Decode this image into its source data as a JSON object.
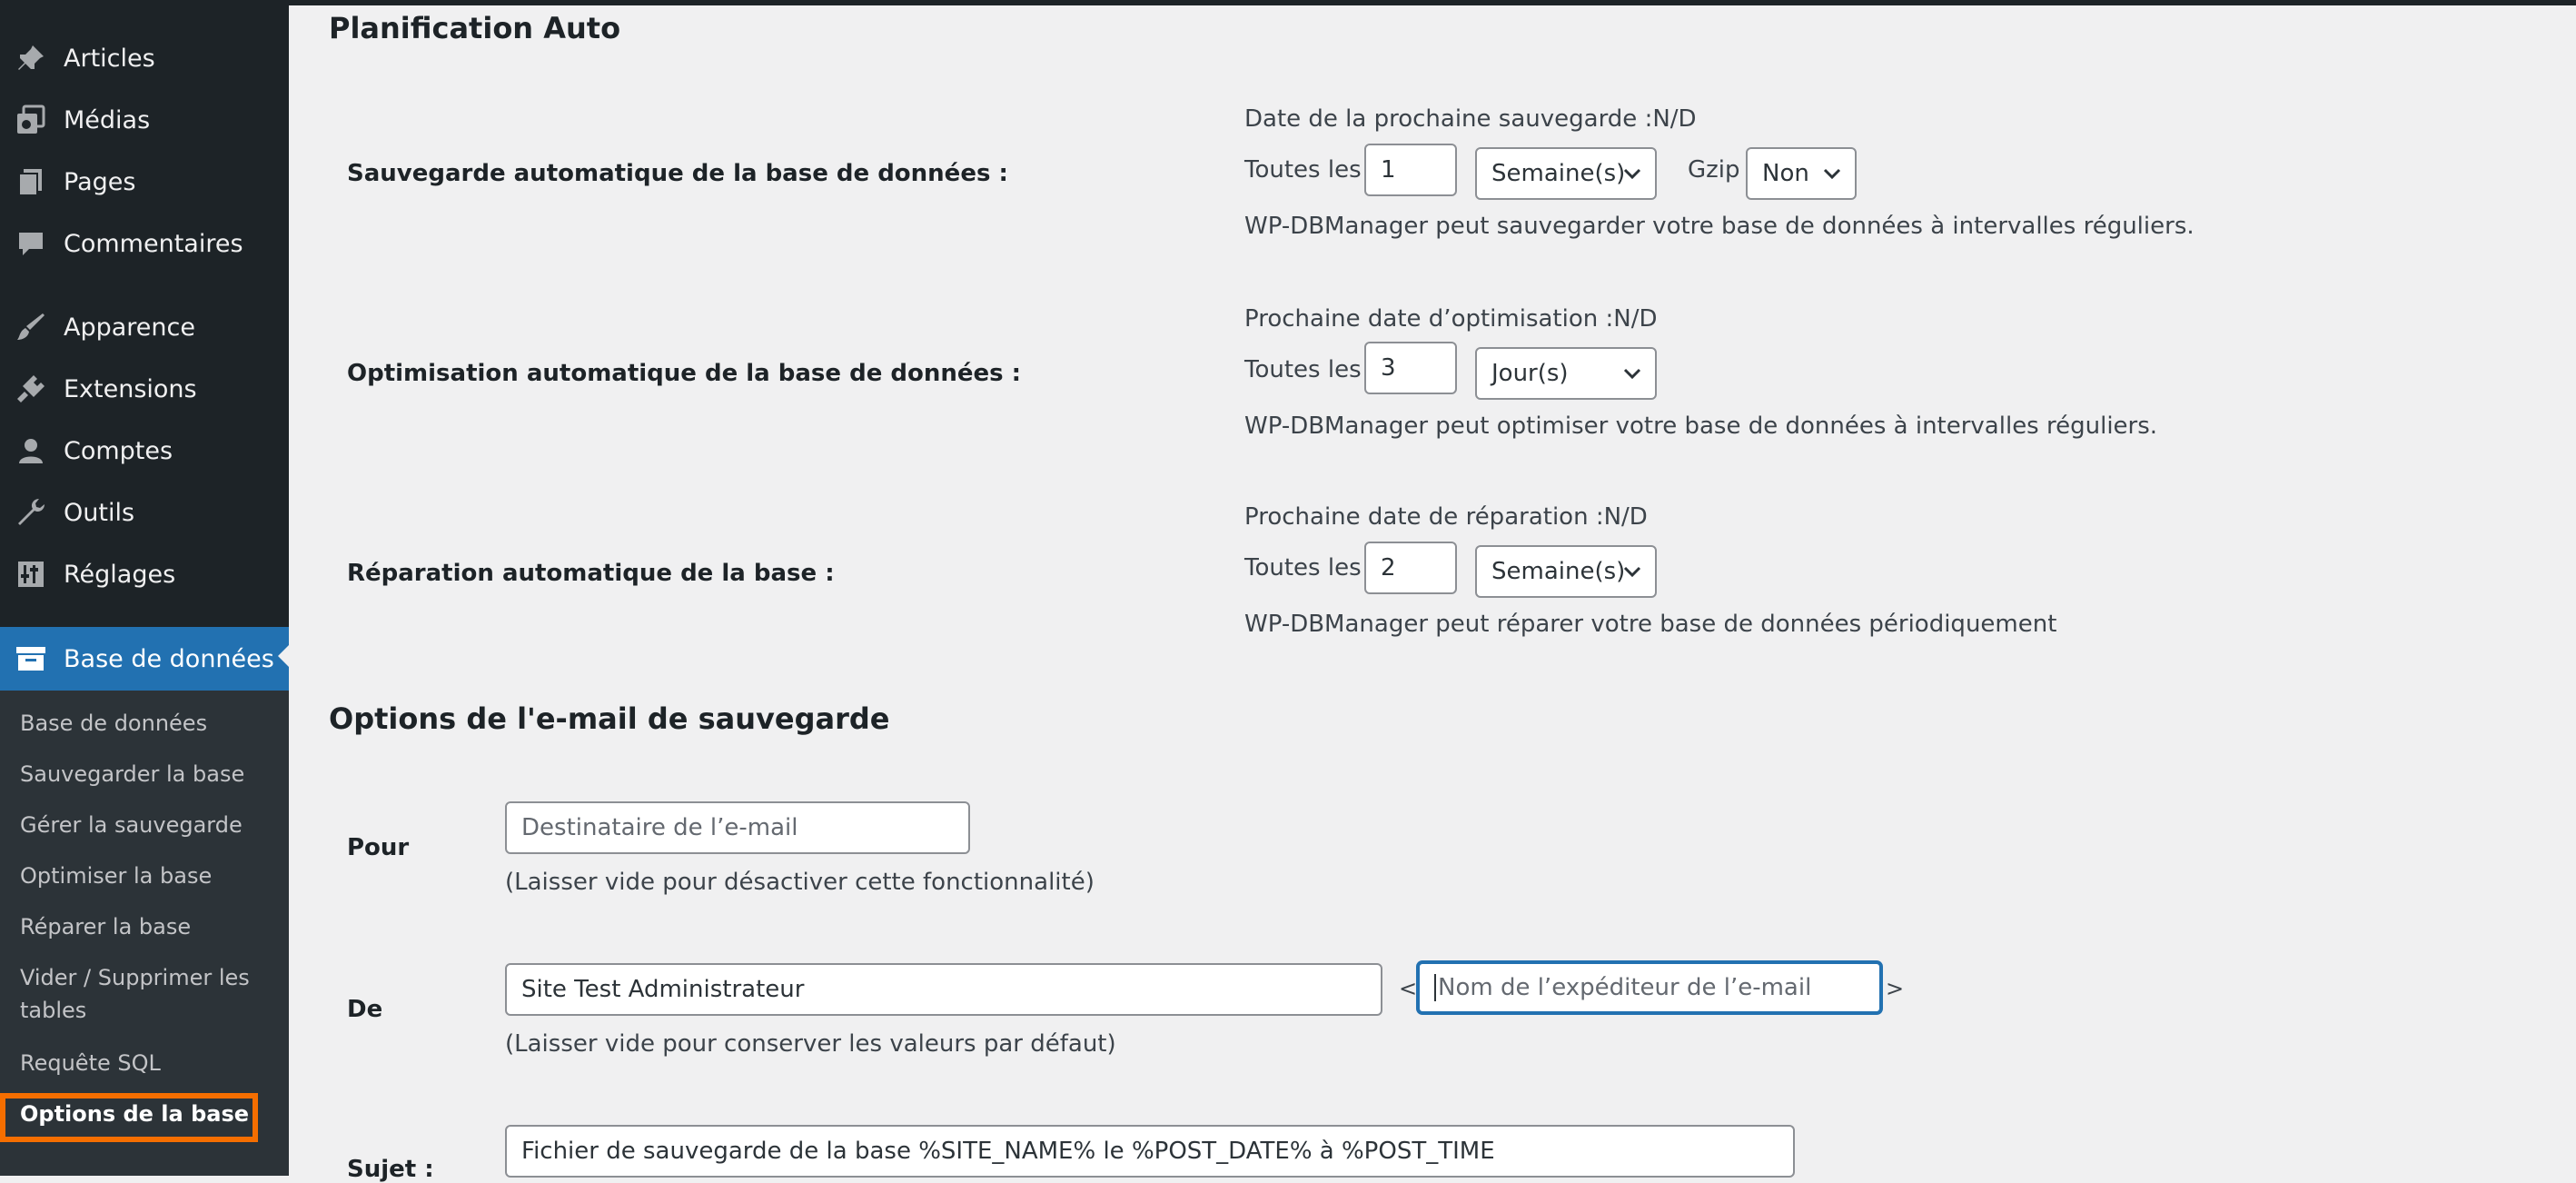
{
  "sidebar": {
    "items": [
      {
        "label": "Articles",
        "icon": "pushpin-icon"
      },
      {
        "label": "Médias",
        "icon": "media-icon"
      },
      {
        "label": "Pages",
        "icon": "pages-icon"
      },
      {
        "label": "Commentaires",
        "icon": "comment-icon"
      },
      {
        "label": "Apparence",
        "icon": "brush-icon"
      },
      {
        "label": "Extensions",
        "icon": "plugin-icon"
      },
      {
        "label": "Comptes",
        "icon": "user-icon"
      },
      {
        "label": "Outils",
        "icon": "wrench-icon"
      },
      {
        "label": "Réglages",
        "icon": "settings-icon"
      },
      {
        "label": "Base de données",
        "icon": "database-icon"
      }
    ],
    "submenu": [
      "Base de données",
      "Sauvegarder la base",
      "Gérer la sauvegarde",
      "Optimiser la base",
      "Réparer la base",
      "Vider / Supprimer les tables",
      "Requête SQL",
      "Options de la base"
    ]
  },
  "auto": {
    "title": "Planification Auto",
    "backup": {
      "label": "Sauvegarde automatique de la base de données :",
      "next": "Date de la prochaine sauvegarde :N/D",
      "every": "Toutes les",
      "value": "1",
      "unit": "Semaine(s)",
      "gzip_label": "Gzip",
      "gzip_value": "Non",
      "help": "WP-DBManager peut sauvegarder votre base de données à intervalles réguliers."
    },
    "optimize": {
      "label": "Optimisation automatique de la base de données :",
      "next": "Prochaine date d’optimisation :N/D",
      "every": "Toutes les",
      "value": "3",
      "unit": "Jour(s)",
      "help": "WP-DBManager peut optimiser votre base de données à intervalles réguliers."
    },
    "repair": {
      "label": "Réparation automatique de la base :",
      "next": "Prochaine date de réparation :N/D",
      "every": "Toutes les",
      "value": "2",
      "unit": "Semaine(s)",
      "help": "WP-DBManager peut réparer votre base de données périodiquement"
    }
  },
  "email": {
    "title": "Options de l'e-mail de sauvegarde",
    "to": {
      "label": "Pour",
      "placeholder": "Destinataire de l’e-mail",
      "help": "(Laisser vide pour désactiver cette fonctionnalité)"
    },
    "from": {
      "label": "De",
      "name_value": "Site Test Administrateur",
      "lt": "<",
      "gt": ">",
      "email_placeholder": "Nom de l’expéditeur de l’e-mail",
      "help": "(Laisser vide pour conserver les valeurs par défaut)"
    },
    "subject": {
      "label": "Sujet :",
      "value": "Fichier de sauvegarde de la base %SITE_NAME% le %POST_DATE% à %POST_TIME"
    }
  }
}
